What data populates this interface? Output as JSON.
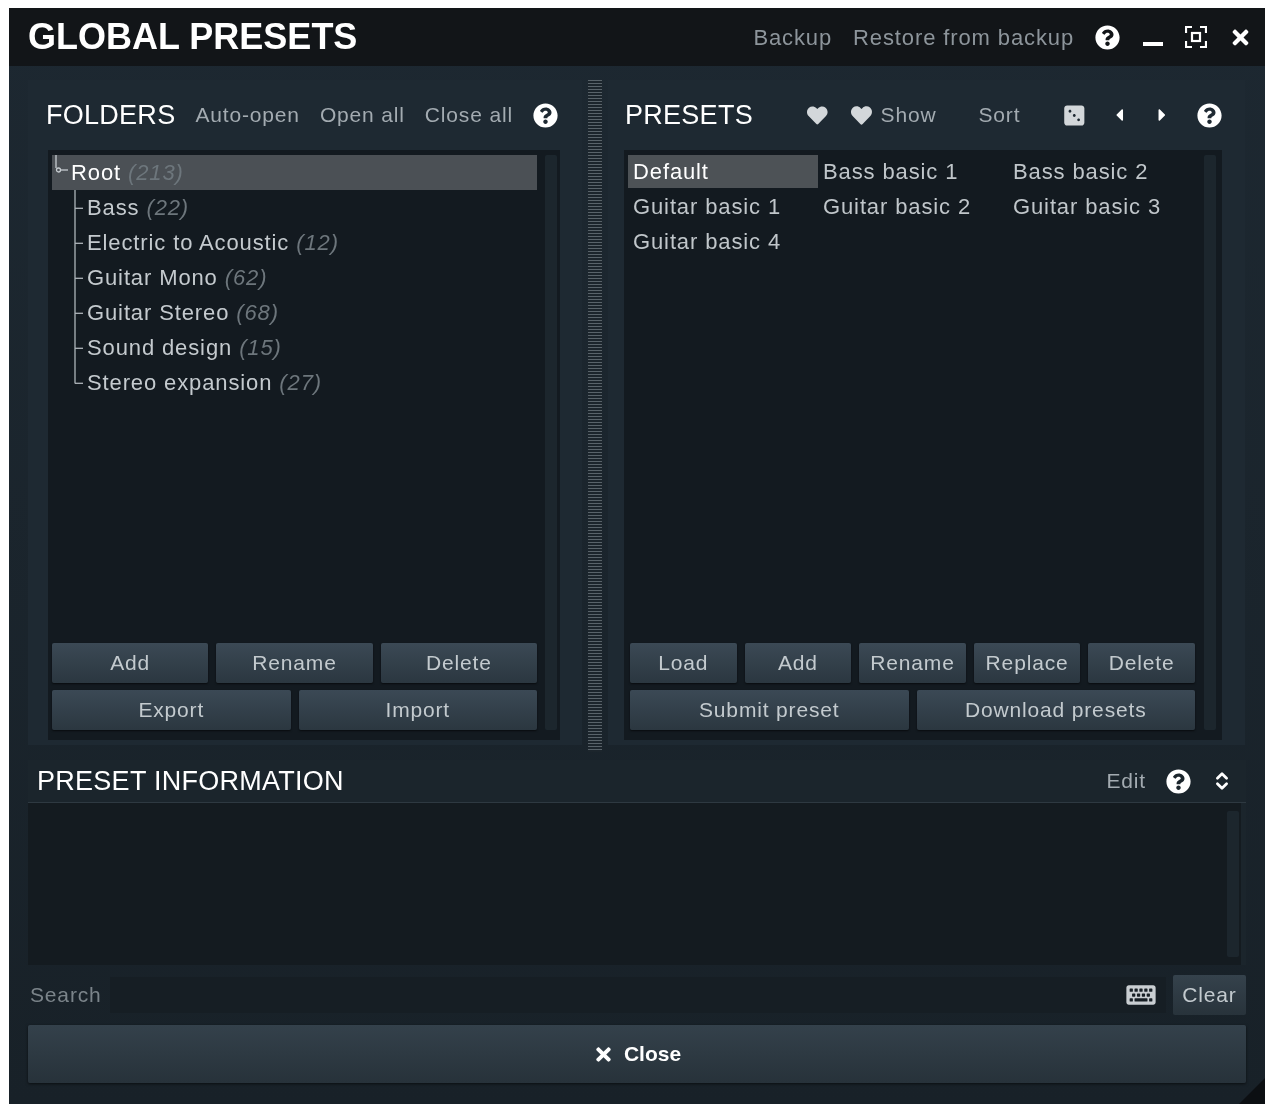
{
  "window": {
    "title": "GLOBAL PRESETS",
    "actions": [
      "Backup",
      "Restore from backup"
    ]
  },
  "folders": {
    "title": "FOLDERS",
    "actions": [
      "Auto-open",
      "Open all",
      "Close all"
    ],
    "tree": [
      {
        "name": "Root",
        "count": "(213)",
        "selected": true,
        "children": [
          {
            "name": "Bass",
            "count": "(22)",
            "selected": false
          },
          {
            "name": "Electric to Acoustic",
            "count": "(12)",
            "selected": false
          },
          {
            "name": "Guitar Mono",
            "count": "(62)",
            "selected": false
          },
          {
            "name": "Guitar Stereo",
            "count": "(68)",
            "selected": false
          },
          {
            "name": "Sound design",
            "count": "(15)",
            "selected": false
          },
          {
            "name": "Stereo expansion",
            "count": "(27)",
            "selected": false
          }
        ]
      }
    ],
    "buttons": [
      [
        "Add",
        "Rename",
        "Delete"
      ],
      [
        "Export",
        "Import"
      ]
    ]
  },
  "presets": {
    "title": "PRESETS",
    "show_button": "Show",
    "sort_button": "Sort",
    "items": [
      {
        "name": "Default",
        "selected": true
      },
      {
        "name": "Bass basic 1",
        "selected": false
      },
      {
        "name": "Bass basic 2",
        "selected": false
      },
      {
        "name": "Guitar basic 1",
        "selected": false
      },
      {
        "name": "Guitar basic 2",
        "selected": false
      },
      {
        "name": "Guitar basic 3",
        "selected": false
      },
      {
        "name": "Guitar basic 4",
        "selected": false
      }
    ],
    "buttons": [
      [
        "Load",
        "Add",
        "Rename",
        "Replace",
        "Delete"
      ],
      [
        "Submit preset",
        "Download presets"
      ]
    ]
  },
  "preset_information": {
    "title": "PRESET INFORMATION",
    "edit_button": "Edit"
  },
  "search": {
    "label": "Search",
    "clear_button": "Clear"
  },
  "close_button": "Close"
}
